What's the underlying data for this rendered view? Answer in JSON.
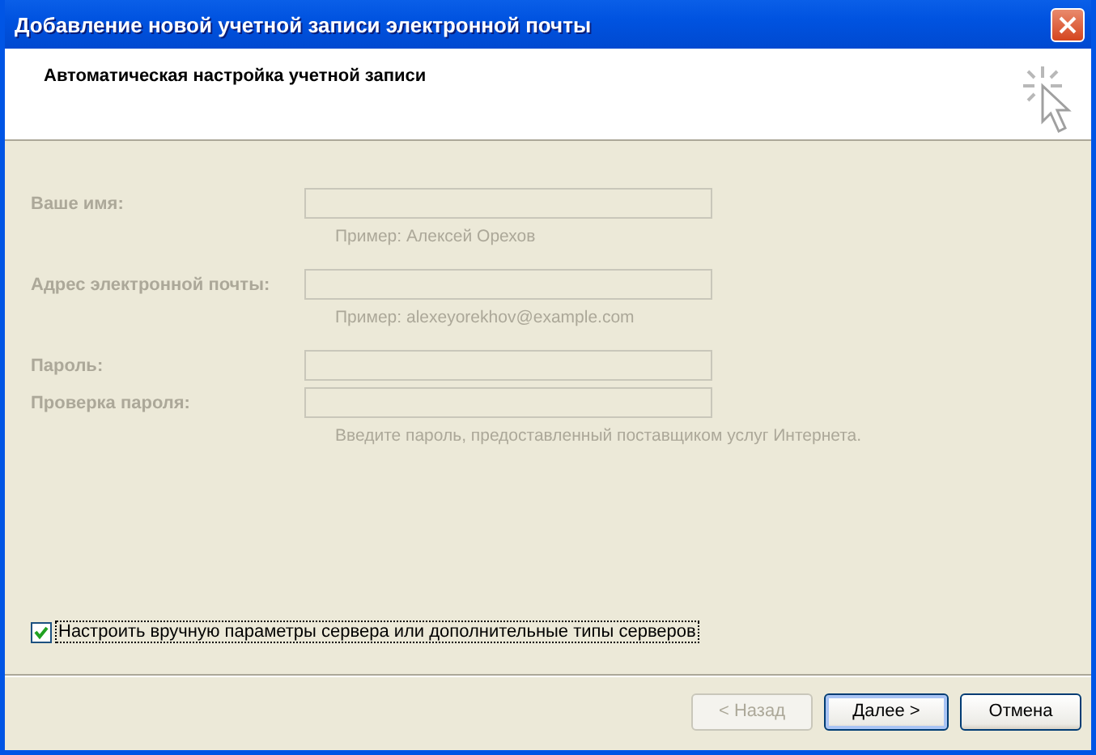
{
  "window": {
    "title": "Добавление новой учетной записи электронной почты"
  },
  "header": {
    "title": "Автоматическая настройка учетной записи"
  },
  "fields": [
    {
      "label": "Ваше имя:",
      "hint": "Пример: Алексей Орехов",
      "disabled": true
    },
    {
      "label": "Адрес электронной почты:",
      "hint": "Пример: alexeyorekhov@example.com",
      "disabled": true
    },
    {
      "label": "Пароль:",
      "disabled": true
    },
    {
      "label": "Проверка пароля:",
      "hint": "Введите пароль, предоставленный поставщиком услуг Интернета.",
      "disabled": true
    }
  ],
  "manual_setup": {
    "label": "Настроить вручную параметры сервера или дополнительные типы серверов",
    "checked": true
  },
  "buttons": [
    {
      "label": "< Назад",
      "disabled": true,
      "default": false
    },
    {
      "label": "Далее >",
      "disabled": false,
      "default": true
    },
    {
      "label": "Отмена",
      "disabled": false,
      "default": false
    }
  ]
}
